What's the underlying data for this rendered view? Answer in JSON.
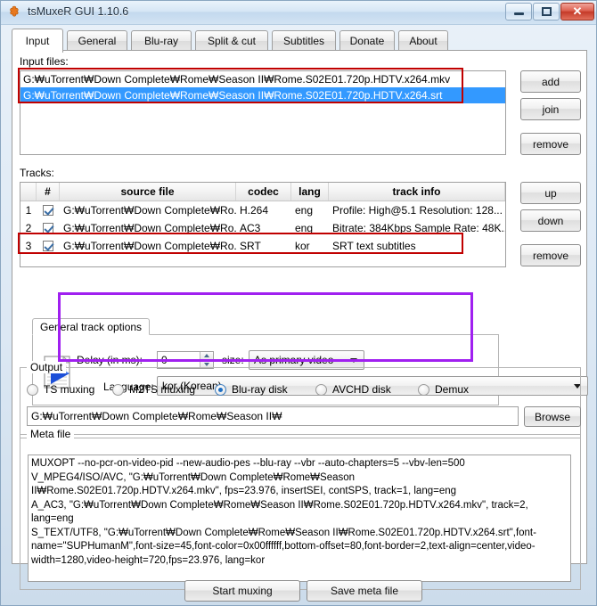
{
  "window": {
    "title": "tsMuxeR GUI 1.10.6",
    "app_icon": "puzzle-piece-icon",
    "buttons": {
      "minimize": "minimize",
      "maximize": "maximize",
      "close": "close"
    }
  },
  "tabs": [
    {
      "label": "Input",
      "active": true
    },
    {
      "label": "General",
      "active": false
    },
    {
      "label": "Blu-ray",
      "active": false
    },
    {
      "label": "Split & cut",
      "active": false
    },
    {
      "label": "Subtitles",
      "active": false
    },
    {
      "label": "Donate",
      "active": false
    },
    {
      "label": "About",
      "active": false
    }
  ],
  "input_files": {
    "label": "Input files:",
    "rows": [
      {
        "path": "G:₩uTorrent₩Down Complete₩Rome₩Season  II₩Rome.S02E01.720p.HDTV.x264.mkv",
        "selected": false
      },
      {
        "path": "G:₩uTorrent₩Down Complete₩Rome₩Season  II₩Rome.S02E01.720p.HDTV.x264.srt",
        "selected": true
      }
    ],
    "buttons": {
      "add": "add",
      "join": "join",
      "remove": "remove"
    }
  },
  "tracks": {
    "label": "Tracks:",
    "columns": [
      "",
      "#",
      "source file",
      "codec",
      "lang",
      "track info"
    ],
    "rows": [
      {
        "index": "1",
        "checked": true,
        "source": "G:₩uTorrent₩Down Complete₩Ro...",
        "codec": "H.264",
        "lang": "eng",
        "info": "Profile: High@5.1  Resolution: 128...",
        "highlighted": false
      },
      {
        "index": "2",
        "checked": true,
        "source": "G:₩uTorrent₩Down Complete₩Ro...",
        "codec": "AC3",
        "lang": "eng",
        "info": "Bitrate: 384Kbps Sample Rate: 48K...",
        "highlighted": false
      },
      {
        "index": "3",
        "checked": true,
        "source": "G:₩uTorrent₩Down Complete₩Ro...",
        "codec": "SRT",
        "lang": "kor",
        "info": "SRT text subtitles",
        "highlighted": true
      }
    ],
    "buttons": {
      "up": "up",
      "down": "down",
      "remove": "remove"
    }
  },
  "track_options": {
    "title": "General track options",
    "icon": "video-track-file-icon",
    "delay_label": "Delay (in ms):",
    "delay_value": "0",
    "size_label": "size:",
    "size_value": "As primary video",
    "language_label": "Language:",
    "language_value": "kor (Korean)"
  },
  "output": {
    "title": "Output",
    "modes": [
      {
        "label": "TS muxing",
        "selected": false
      },
      {
        "label": "M2TS muxing",
        "selected": false
      },
      {
        "label": "Blu-ray disk",
        "selected": true
      },
      {
        "label": "AVCHD disk",
        "selected": false
      },
      {
        "label": "Demux",
        "selected": false
      }
    ],
    "path_value": "G:₩uTorrent₩Down Complete₩Rome₩Season  II₩",
    "browse_label": "Browse"
  },
  "meta_file": {
    "title": "Meta file",
    "lines": [
      "MUXOPT --no-pcr-on-video-pid --new-audio-pes --blu-ray --vbr  --auto-chapters=5 --vbv-len=500",
      "V_MPEG4/ISO/AVC, \"G:₩uTorrent₩Down Complete₩Rome₩Season",
      " II₩Rome.S02E01.720p.HDTV.x264.mkv\", fps=23.976, insertSEI, contSPS, track=1, lang=eng",
      "A_AC3, \"G:₩uTorrent₩Down Complete₩Rome₩Season  II₩Rome.S02E01.720p.HDTV.x264.mkv\", track=2,",
      "lang=eng",
      "S_TEXT/UTF8, \"G:₩uTorrent₩Down Complete₩Rome₩Season  II₩Rome.S02E01.720p.HDTV.x264.srt\",font-",
      "name=\"SUPHumanM\",font-size=45,font-color=0x00ffffff,bottom-offset=80,font-border=2,text-align=center,video-",
      "width=1280,video-height=720,fps=23.976, lang=kor"
    ]
  },
  "footer": {
    "start_muxing": "Start muxing",
    "save_meta_file": "Save meta file"
  },
  "colors": {
    "highlight_red": "#c00000",
    "highlight_purple": "#a020f0",
    "selection_blue": "#3399ff"
  }
}
